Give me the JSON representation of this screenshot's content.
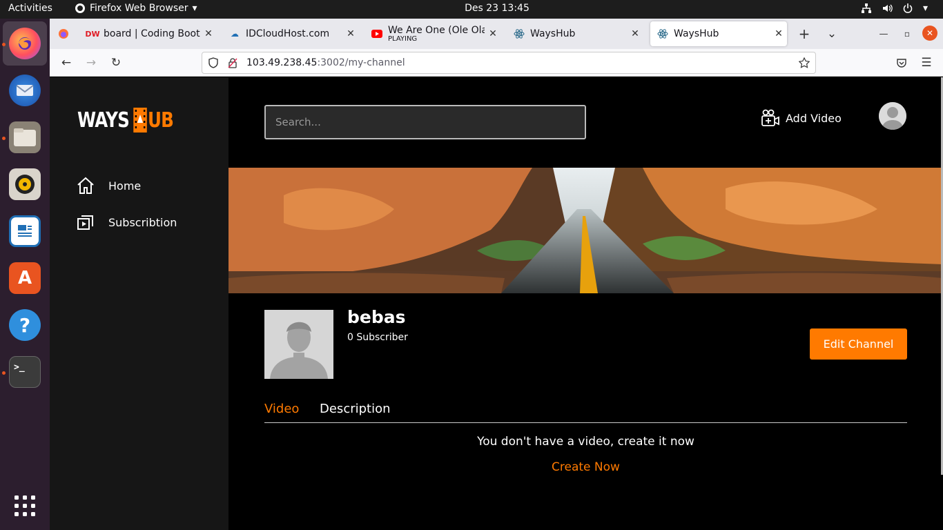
{
  "system": {
    "activities": "Activities",
    "app_name": "Firefox Web Browser",
    "clock": "Des 23  13:45"
  },
  "dock": {
    "items": [
      "firefox",
      "thunderbird",
      "files",
      "rhythmbox",
      "libreoffice-writer",
      "software",
      "help",
      "terminal",
      "app-grid"
    ]
  },
  "browser": {
    "tabs": [
      {
        "title": "board | Coding Bootca",
        "subtitle": ""
      },
      {
        "title": "IDCloudHost.com",
        "subtitle": ""
      },
      {
        "title": "We Are One (Ole Ola) [",
        "subtitle": "PLAYING"
      },
      {
        "title": "WaysHub",
        "subtitle": ""
      },
      {
        "title": "WaysHub",
        "subtitle": ""
      }
    ],
    "url_host": "103.49.238.45",
    "url_path": ":3002/my-channel"
  },
  "app": {
    "logo_left": "WAYS",
    "logo_right": "UB",
    "nav": [
      {
        "label": "Home",
        "icon": "home-icon"
      },
      {
        "label": "Subscribtion",
        "icon": "subscription-icon"
      }
    ],
    "search_placeholder": "Search...",
    "add_video_label": "Add Video",
    "channel": {
      "name": "bebas",
      "subscribers": "0 Subscriber",
      "edit_label": "Edit Channel"
    },
    "tabs": [
      "Video",
      "Description"
    ],
    "active_tab": "Video",
    "empty_message": "You don't have a video, create it now",
    "create_label": "Create Now"
  },
  "colors": {
    "accent": "#ff7a00",
    "sidebar_bg": "#161616",
    "page_bg": "#000000",
    "dock_bg": "#2c1e2e"
  }
}
